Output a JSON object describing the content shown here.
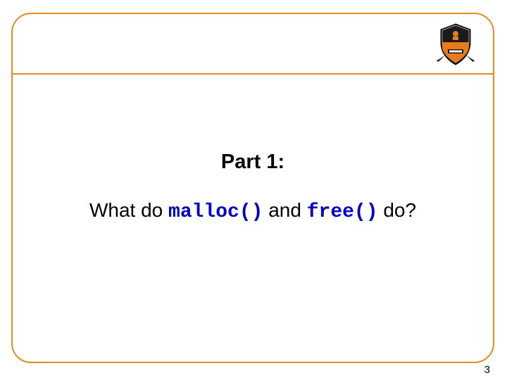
{
  "header": {
    "crest_label": "princeton-crest"
  },
  "content": {
    "part_title": "Part 1:",
    "q_prefix": "What do ",
    "code1": "malloc()",
    "q_mid": " and ",
    "code2": "free()",
    "q_suffix": " do?"
  },
  "page_number": "3"
}
